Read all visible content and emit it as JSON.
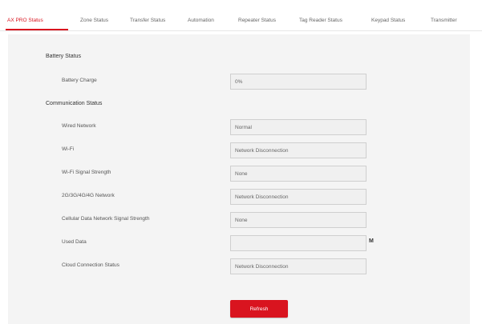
{
  "tabs": [
    {
      "label": "AX PRO Status",
      "active": true
    },
    {
      "label": "Zone Status"
    },
    {
      "label": "Transfer Status"
    },
    {
      "label": "Automation"
    },
    {
      "label": "Repeater Status"
    },
    {
      "label": "Tag Reader Status"
    },
    {
      "label": "Keypad Status"
    },
    {
      "label": "Transmitter"
    }
  ],
  "battery": {
    "title": "Battery Status",
    "charge_label": "Battery Charge",
    "charge_value": "0%"
  },
  "communication": {
    "title": "Communication Status",
    "rows": [
      {
        "label": "Wired Network",
        "value": "Normal"
      },
      {
        "label": "Wi-Fi",
        "value": "Network Disconnection"
      },
      {
        "label": "Wi-Fi Signal Strength",
        "value": "None"
      },
      {
        "label": "2G/3G/4G/4G Network",
        "value": "Network Disconnection"
      },
      {
        "label": "Cellular Data Network Signal Strength",
        "value": "None"
      },
      {
        "label": "Used Data",
        "value": "",
        "unit": "M"
      },
      {
        "label": "Cloud Connection Status",
        "value": "Network Disconnection"
      }
    ]
  },
  "refresh_label": "Refresh",
  "colors": {
    "accent": "#d9141f"
  }
}
